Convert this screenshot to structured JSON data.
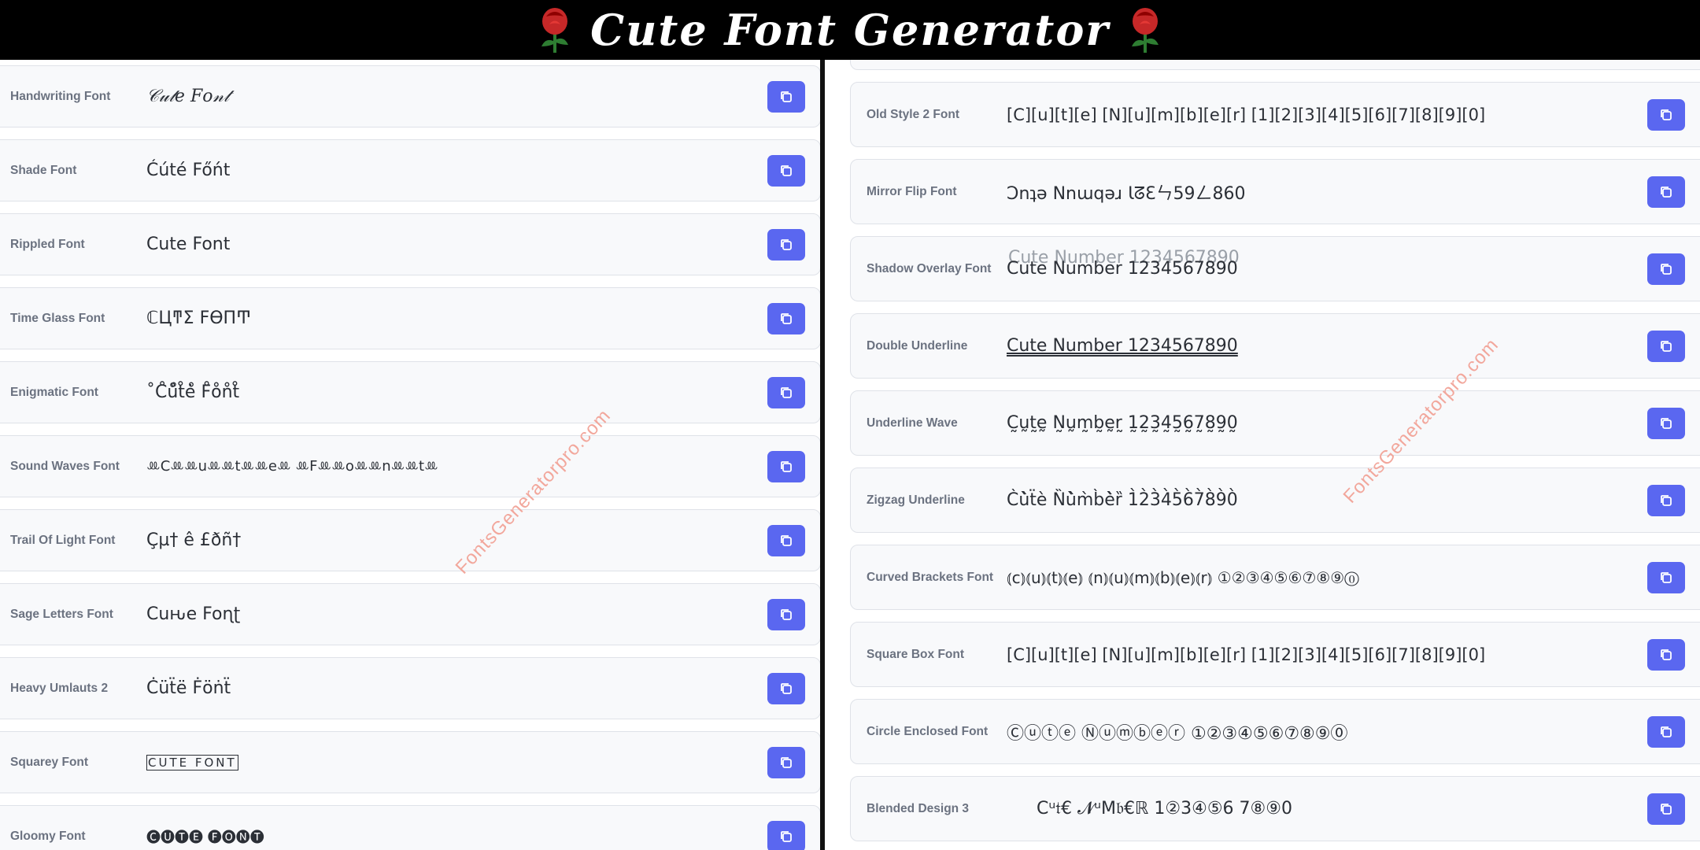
{
  "header": {
    "title": "Cute Font Generator",
    "left_icon": "rose-icon",
    "right_icon": "rose-icon"
  },
  "copy_icon": "copy-icon",
  "watermark": "FontsGeneratorpro.com",
  "colors": {
    "accent": "#5a67f0",
    "card_bg": "#f8f9fb",
    "banner_bg": "#000000"
  },
  "left_fonts": [
    {
      "label": "Handwriting Font",
      "text": "𝒞𝓊𝓉𝑒 𝐹𝑜𝓃𝓉"
    },
    {
      "label": "Shade Font",
      "text": "Ćúté Főńt"
    },
    {
      "label": "Rippled Font",
      "text": "Cute Font"
    },
    {
      "label": "Time Glass Font",
      "text": "ℂЦͳΣ ϜӨПͲ"
    },
    {
      "label": "Enigmatic Font",
      "text": "˚C̊ů̊t̊ė̊ F̊o̊n̊t̊"
    },
    {
      "label": "Sound Waves Font",
      "text": "ꔛCꔛꔛuꔛꔛtꔛꔛeꔛ ꔛFꔛꔛoꔛꔛnꔛꔛtꔛ"
    },
    {
      "label": "Trail Of Light Font",
      "text": "Çµ† ê £ðñ†"
    },
    {
      "label": "Sage Letters Font",
      "text": "Cuԋe Foɳʈ"
    },
    {
      "label": "Heavy Umlauts 2",
      "text": "Ċüẗë Ḟöṅẗ"
    },
    {
      "label": "Squarey Font",
      "text": "CUTE FONT"
    },
    {
      "label": "Gloomy Font",
      "text": "🅒🅤🅣🅔 🅕🅞🅝🅣"
    }
  ],
  "right_fonts": [
    {
      "label": "Old Style 2 Font",
      "text": "[C][u][t][e] [N][u][m][b][e][r] [1][2][3][4][5][6][7][8][9][0]"
    },
    {
      "label": "Mirror Flip Font",
      "text": "Ɔnʇǝ Nnɯqǝɹ ƖᘔƐㄣ59ㄥ860"
    },
    {
      "label": "Shadow Overlay Font",
      "text": "Cute Number 1234567890"
    },
    {
      "label": "Double Underline",
      "text": "Cute Number 1234567890"
    },
    {
      "label": "Underline Wave",
      "text": "C̰ṵt̰ḛ N̰ṵm̰b̰ḛr̰ 1̰2̰3̰4̰5̰6̰7̰8̰9̰0̰"
    },
    {
      "label": "Zigzag Underline",
      "text": "C̀ù̀ẗè N̏ù̀m̀b̀è̀ȑ 1̀2̀3̀4̀5̀6̀7̀8̀9̀0̀"
    },
    {
      "label": "Curved Brackets Font",
      "text": "⦅c⦆⦅u⦆⦅t⦆⦅e⦆ ⦅n⦆⦅u⦆⦅m⦆⦅b⦆⦅e⦆⦅r⦆ ①②③④⑤⑥⑦⑧⑨⓪"
    },
    {
      "label": "Square Box Font",
      "text": "[C][u][t][e] [N][u][m][b][e][r] [1][2][3][4][5][6][7][8][9][0]"
    },
    {
      "label": "Circle Enclosed Font",
      "text": "Ⓒⓤⓣⓔ Ⓝⓤⓜⓑⓔⓡ ①②③④⑤⑥⑦⑧⑨⓪"
    },
    {
      "label": "Blended Design 3",
      "text": "Cᵘ𝔱€ 𝓝ᵘМ𝔟€ℝ 1②3④⑤6 7⑧⑨0"
    }
  ]
}
